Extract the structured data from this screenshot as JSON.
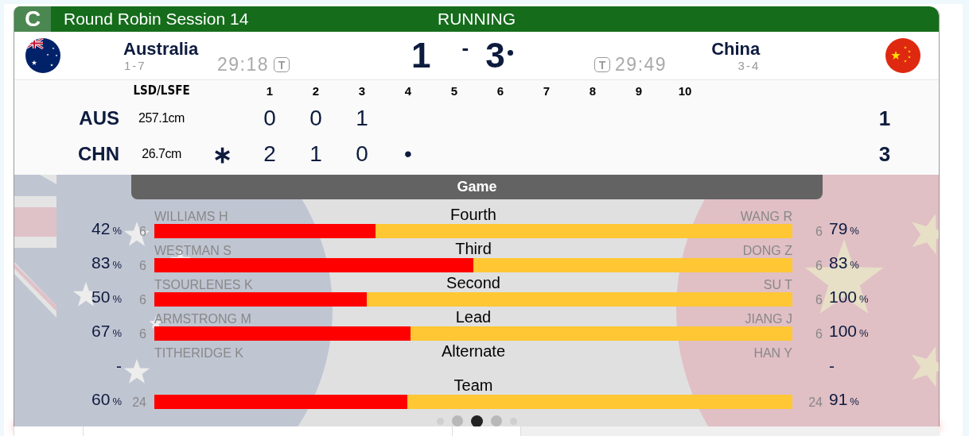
{
  "header": {
    "badge": "C",
    "title": "Round Robin Session 14",
    "status": "RUNNING"
  },
  "teams": [
    {
      "name": "Australia",
      "record": "1-7",
      "clock": "29:18",
      "timeout_label": "T",
      "score": "1",
      "hammer": false,
      "kind": "australia"
    },
    {
      "name": "China",
      "record": "3-4",
      "clock": "29:49",
      "timeout_label": "T",
      "score": "3",
      "hammer": true,
      "kind": "china"
    }
  ],
  "score_separator": "-",
  "linescore": {
    "lsd_heading": "LSD/LSFE",
    "ends": [
      "1",
      "2",
      "3",
      "4",
      "5",
      "6",
      "7",
      "8",
      "9",
      "10"
    ],
    "rows": [
      {
        "code": "AUS",
        "lsd": "257.1cm",
        "ends": [
          "0",
          "0",
          "1"
        ],
        "total": "1"
      },
      {
        "code": "CHN",
        "lsd": "26.7cm",
        "lsfe_mark": "∗",
        "ends": [
          "2",
          "1",
          "0",
          "•"
        ],
        "total": "3"
      }
    ]
  },
  "game_tab": "Game",
  "positions": [
    {
      "position": "Fourth",
      "left": {
        "name": "WILLIAMS H",
        "count": "6",
        "pct": "42",
        "unit": "%"
      },
      "right": {
        "name": "WANG R",
        "count": "6",
        "pct": "79",
        "unit": "%"
      },
      "level": 0.347
    },
    {
      "position": "Third",
      "left": {
        "name": "WESTMAN S",
        "count": "6",
        "pct": "83",
        "unit": "%"
      },
      "right": {
        "name": "DONG Z",
        "count": "6",
        "pct": "83",
        "unit": "%"
      },
      "level": 0.5
    },
    {
      "position": "Second",
      "left": {
        "name": "TSOURLENES K",
        "count": "6",
        "pct": "50",
        "unit": "%"
      },
      "right": {
        "name": "SU T",
        "count": "6",
        "pct": "100",
        "unit": "%"
      },
      "level": 0.333
    },
    {
      "position": "Lead",
      "left": {
        "name": "ARMSTRONG M",
        "count": "6",
        "pct": "67",
        "unit": "%"
      },
      "right": {
        "name": "JIANG J",
        "count": "6",
        "pct": "100",
        "unit": "%"
      },
      "level": 0.401
    },
    {
      "position": "Alternate",
      "left": {
        "name": "TITHERIDGE K",
        "pct": "-"
      },
      "right": {
        "name": "HAN Y",
        "pct": "-"
      }
    },
    {
      "position": "Team",
      "left": {
        "count": "24",
        "pct": "60",
        "unit": "%"
      },
      "right": {
        "count": "24",
        "pct": "91",
        "unit": "%"
      },
      "level": 0.397
    }
  ],
  "pager": [
    {
      "selected": false
    },
    {
      "selected": false
    },
    {
      "selected": true
    },
    {
      "selected": false
    },
    {
      "selected": false
    }
  ]
}
